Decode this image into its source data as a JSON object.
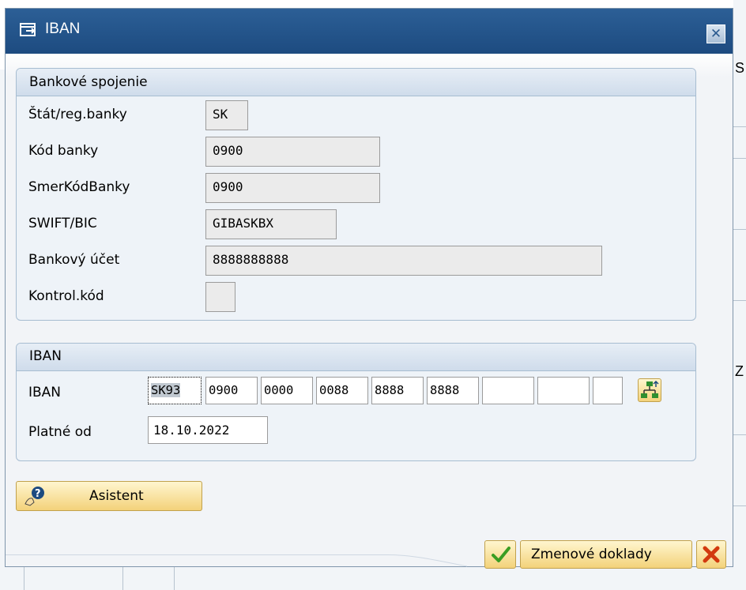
{
  "window": {
    "title": "IBAN"
  },
  "bank_group": {
    "title": "Bankové spojenie",
    "rows": [
      {
        "label": "Štát/reg.banky",
        "value": "SK"
      },
      {
        "label": "Kód banky",
        "value": "0900"
      },
      {
        "label": "SmerKódBanky",
        "value": "0900"
      },
      {
        "label": "SWIFT/BIC",
        "value": "GIBASKBX"
      },
      {
        "label": "Bankový účet",
        "value": "8888888888"
      },
      {
        "label": "Kontrol.kód",
        "value": ""
      }
    ]
  },
  "iban_group": {
    "title": "IBAN",
    "iban_label": "IBAN",
    "iban_segments": [
      "SK93",
      "0900",
      "0000",
      "0088",
      "8888",
      "8888",
      "",
      "",
      ""
    ],
    "valid_from_label": "Platné od",
    "valid_from_value": "18.10.2022"
  },
  "buttons": {
    "assistant": "Asistent",
    "change_docs": "Zmenové doklady"
  },
  "background": {
    "right_glyph_1": "S",
    "right_glyph_2": "Z"
  },
  "icons": {
    "title": "dialog-window-icon",
    "close": "close-icon",
    "assistant": "assistant-help-icon",
    "hierarchy": "hierarchy-icon",
    "confirm": "checkmark-icon",
    "cancel": "cancel-icon"
  },
  "colors": {
    "titlebar": "#1d4b80",
    "button_face": "#f3d27a",
    "group_border": "#a7bdd1",
    "confirm_green": "#3a9d23",
    "cancel_red": "#d23a0e"
  }
}
